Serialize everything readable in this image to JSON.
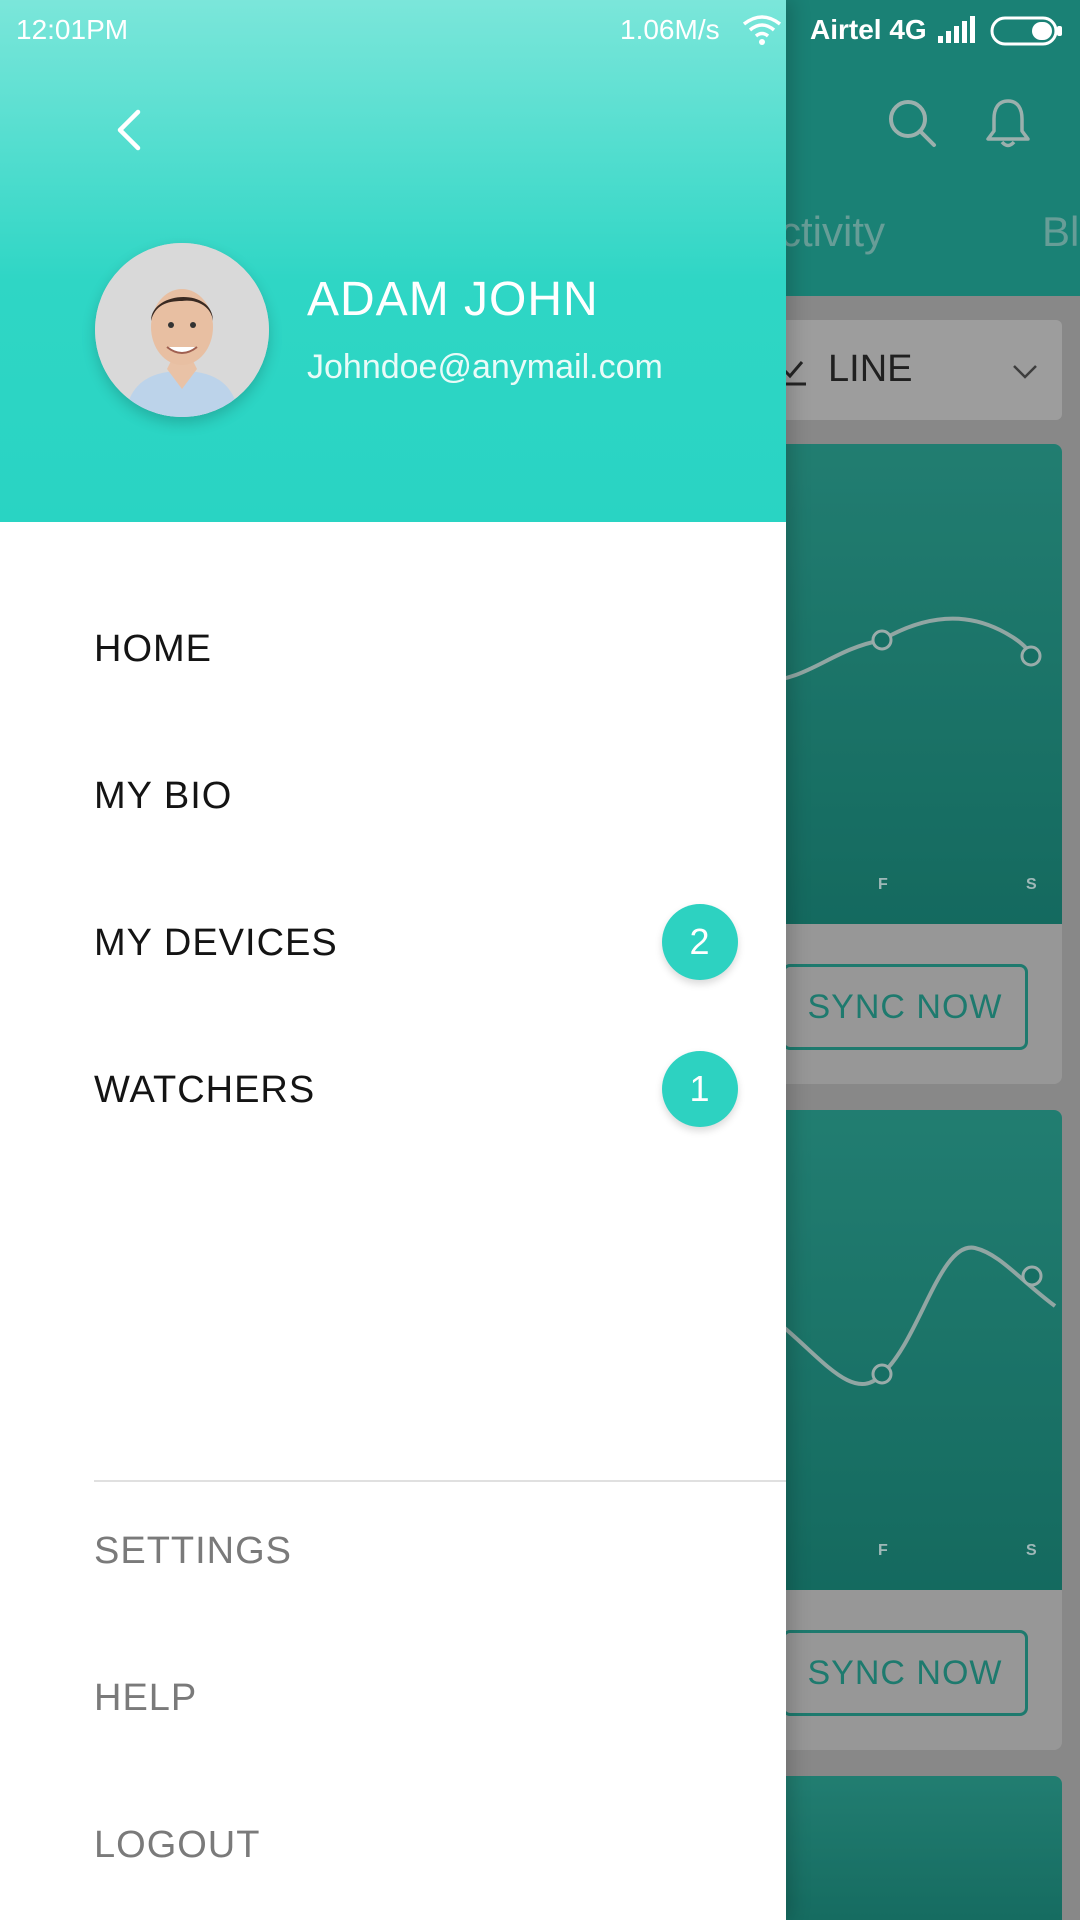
{
  "status_bar": {
    "time": "12:01PM",
    "speed": "1.06M/s",
    "carrier": "Airtel 4G"
  },
  "background": {
    "tabs": [
      "ctivity",
      "Bl"
    ],
    "chart_type_select": "LINE",
    "chart1_xlabels": [
      "F",
      "S"
    ],
    "chart2_xlabels": [
      "F",
      "S"
    ],
    "sync_button": "SYNC NOW",
    "accent_color": "#29d4c3"
  },
  "drawer": {
    "profile": {
      "name": "ADAM JOHN",
      "email": "Johndoe@anymail.com"
    },
    "menu": [
      {
        "label": "HOME"
      },
      {
        "label": "MY BIO"
      },
      {
        "label": "MY DEVICES",
        "badge": "2"
      },
      {
        "label": "WATCHERS",
        "badge": "1"
      }
    ],
    "secondary_menu": [
      {
        "label": "SETTINGS"
      },
      {
        "label": "HELP"
      },
      {
        "label": "LOGOUT"
      }
    ]
  }
}
